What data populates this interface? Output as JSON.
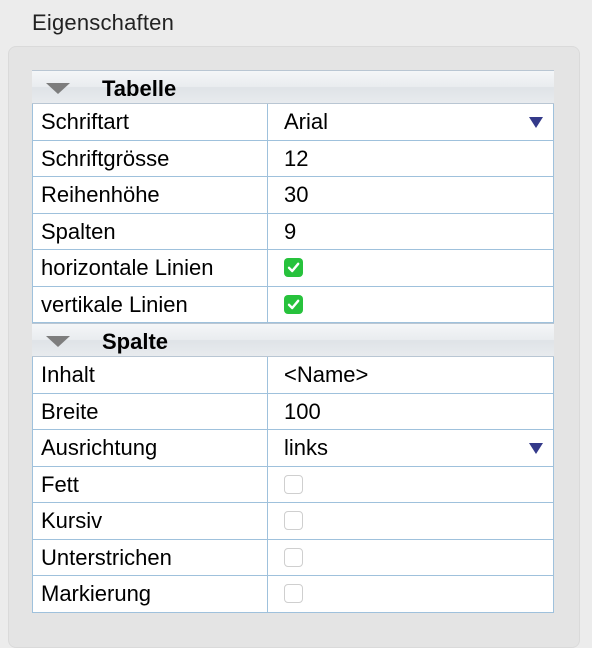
{
  "panel": {
    "title": "Eigenschaften"
  },
  "sections": [
    {
      "label": "Tabelle",
      "rows": [
        {
          "key": "Schriftart",
          "type": "dropdown",
          "value": "Arial"
        },
        {
          "key": "Schriftgrösse",
          "type": "text",
          "value": "12"
        },
        {
          "key": "Reihenhöhe",
          "type": "text",
          "value": "30"
        },
        {
          "key": "Spalten",
          "type": "text",
          "value": "9"
        },
        {
          "key": "horizontale Linien",
          "type": "checkbox",
          "checked": true
        },
        {
          "key": "vertikale Linien",
          "type": "checkbox",
          "checked": true
        }
      ]
    },
    {
      "label": "Spalte",
      "rows": [
        {
          "key": "Inhalt",
          "type": "text",
          "value": "<Name>"
        },
        {
          "key": "Breite",
          "type": "text",
          "value": "100"
        },
        {
          "key": "Ausrichtung",
          "type": "dropdown",
          "value": "links"
        },
        {
          "key": "Fett",
          "type": "checkbox",
          "checked": false
        },
        {
          "key": "Kursiv",
          "type": "checkbox",
          "checked": false
        },
        {
          "key": "Unterstrichen",
          "type": "checkbox",
          "checked": false
        },
        {
          "key": "Markierung",
          "type": "checkbox",
          "checked": false
        }
      ]
    }
  ],
  "icons": {
    "section_toggle": "disclosure-triangle-down-icon",
    "dropdown": "dropdown-arrow-icon",
    "checkbox_on": "checkmark-icon"
  },
  "colors": {
    "grid_line": "#9fc1dc",
    "checkbox_checked": "#27c23c",
    "dropdown_arrow": "#343a8a"
  }
}
